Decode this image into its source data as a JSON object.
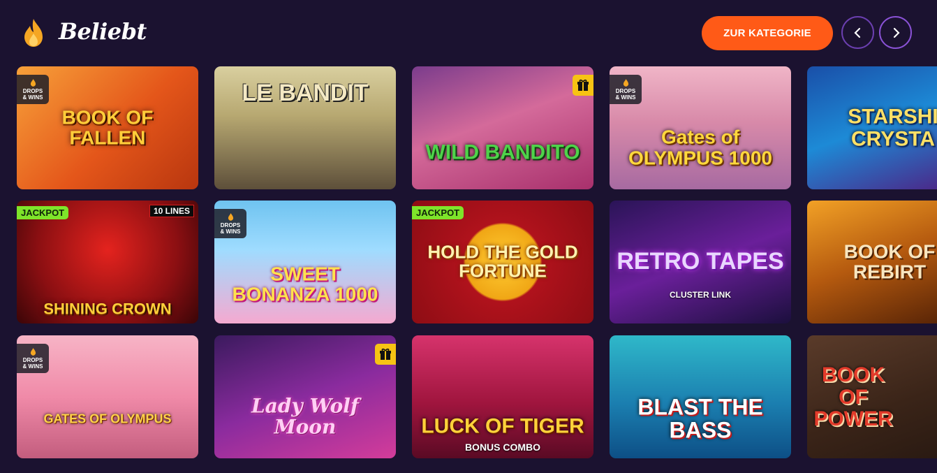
{
  "header": {
    "title": "Beliebt",
    "category_button": "ZUR KATEGORIE",
    "icon": "flame-icon",
    "accent": "#ff5a17"
  },
  "badges": {
    "drops_line1": "DROPS",
    "drops_line2": "& WINS",
    "jackpot": "JACKPOT",
    "lines": "10 LINES"
  },
  "games": [
    {
      "title": "BOOK OF FALLEN",
      "badge": "drops"
    },
    {
      "title": "LE BANDIT",
      "badge": ""
    },
    {
      "title": "WILD BANDITO",
      "badge": "gift"
    },
    {
      "title": "Gates of OLYMPUS 1000",
      "badge": "drops"
    },
    {
      "title": "STARSHI CRYSTA",
      "badge": ""
    },
    {
      "title": "SHINING CROWN",
      "badge": "jackpot-lines"
    },
    {
      "title": "SWEET BONANZA 1000",
      "badge": "drops"
    },
    {
      "title": "HOLD THE GOLD FORTUNE",
      "badge": "jackpot"
    },
    {
      "title": "RETRO TAPES",
      "subtitle": "CLUSTER LINK",
      "badge": ""
    },
    {
      "title": "BOOK OF REBIRT",
      "badge": ""
    },
    {
      "title": "GATES OF OLYMPUS",
      "badge": "drops"
    },
    {
      "title": "Lady Wolf Moon",
      "badge": "gift"
    },
    {
      "title": "LUCK OF TIGER",
      "subtitle": "BONUS COMBO",
      "badge": ""
    },
    {
      "title": "BLAST THE BASS",
      "badge": ""
    },
    {
      "title": "BOOK OF POWER",
      "badge": ""
    }
  ]
}
